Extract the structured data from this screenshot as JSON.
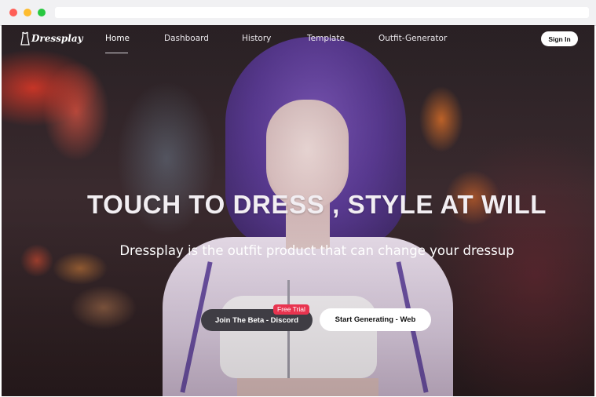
{
  "brand": {
    "name": "Dressplay",
    "logo_icon": "hanger-dress-icon"
  },
  "nav": {
    "items": [
      {
        "label": "Home",
        "active": true
      },
      {
        "label": "Dashboard",
        "active": false
      },
      {
        "label": "History",
        "active": false
      },
      {
        "label": "Template",
        "active": false
      },
      {
        "label": "Outfit-Generator",
        "active": false
      }
    ],
    "signin_label": "Sign In"
  },
  "hero": {
    "headline": "TOUCH TO DRESS , STYLE AT WILL",
    "subheadline": "Dressplay is the outfit product that can change your dressup",
    "image_subject": "woman with purple hair in white crop jacket, city night bokeh"
  },
  "cta": {
    "beta_label": "Join The Beta - Discord",
    "beta_badge": "Free Trial",
    "generate_label": "Start Generating - Web"
  },
  "colors": {
    "badge": "#e8344f",
    "beta_button": "#3f3d44",
    "generate_button": "#ffffff",
    "hair": "#6a45a8"
  }
}
